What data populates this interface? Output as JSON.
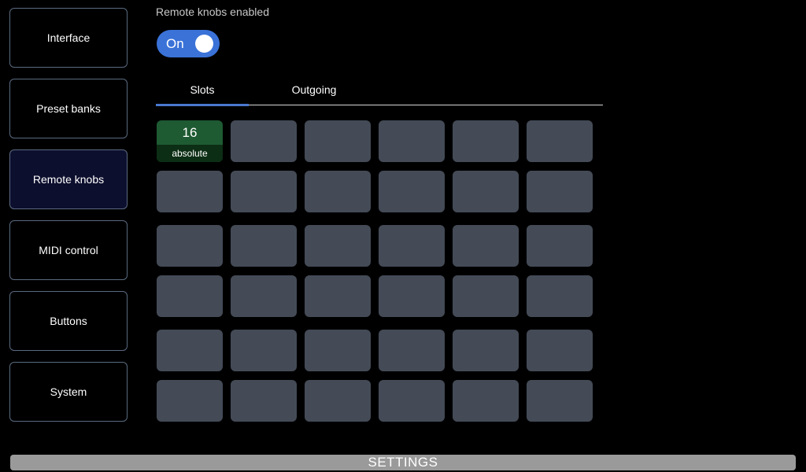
{
  "sidebar": {
    "items": [
      {
        "label": "Interface",
        "active": false
      },
      {
        "label": "Preset banks",
        "active": false
      },
      {
        "label": "Remote knobs",
        "active": true
      },
      {
        "label": "MIDI control",
        "active": false
      },
      {
        "label": "Buttons",
        "active": false
      },
      {
        "label": "System",
        "active": false
      }
    ]
  },
  "main": {
    "section_label": "Remote knobs enabled",
    "toggle": {
      "label": "On",
      "state": true
    },
    "tabs": [
      {
        "label": "Slots",
        "selected": true
      },
      {
        "label": "Outgoing",
        "selected": false
      }
    ],
    "slot_grid": {
      "rows": 6,
      "columns": 6,
      "assigned": [
        {
          "index": 0,
          "value": "16",
          "mode": "absolute"
        }
      ]
    }
  },
  "footer": {
    "label": "SETTINGS"
  },
  "colors": {
    "accent": "#3a72d8",
    "slot_empty": "#444b57",
    "slot_assigned": "#1e5a32",
    "sidebar_active": "#0d0f2e"
  }
}
